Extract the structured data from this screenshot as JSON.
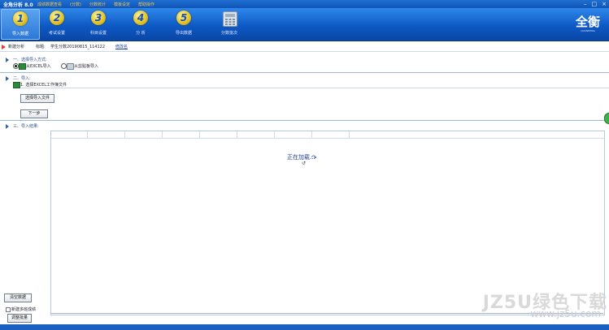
{
  "app": {
    "title": "全角分析 8.0"
  },
  "menu": [
    "成绩数据查看",
    "(分数)",
    "分数统计",
    "模板设定",
    "帮助操作"
  ],
  "toolbar": [
    {
      "num": "1",
      "label": "导入数据",
      "active": true
    },
    {
      "num": "2",
      "label": "考试设置",
      "active": false
    },
    {
      "num": "3",
      "label": "科目设置",
      "active": false
    },
    {
      "num": "4",
      "label": "分 析",
      "active": false
    },
    {
      "num": "5",
      "label": "导出数据",
      "active": false
    },
    {
      "num": "",
      "label": "分数批次",
      "active": false
    }
  ],
  "logo": {
    "text": "全衡",
    "sub": "QUANHENG"
  },
  "info": {
    "left": "新建分析",
    "title_label": "标题:",
    "title_value": "学生分数20190815_114122",
    "link": "修改名"
  },
  "step1": {
    "heading": "一、选择导入方式:",
    "opt1": "从EXCEL导入",
    "opt2": "从剪贴板导入"
  },
  "step2": {
    "heading": "二、导入:",
    "sub": "1. 选择EXCEL工作簿文件",
    "choose_btn": "选择导入文件",
    "next_btn": "下一步"
  },
  "step3": {
    "heading": "三、导入结果:",
    "loading": "正在加载..."
  },
  "left_bottom": {
    "clear_btn": "清空数据",
    "checkbox": "新建多班成绩",
    "adjust_btn": "调整批量"
  },
  "watermark": {
    "main": "JZ5U绿色下载",
    "sub": "www.jz5u.com"
  }
}
